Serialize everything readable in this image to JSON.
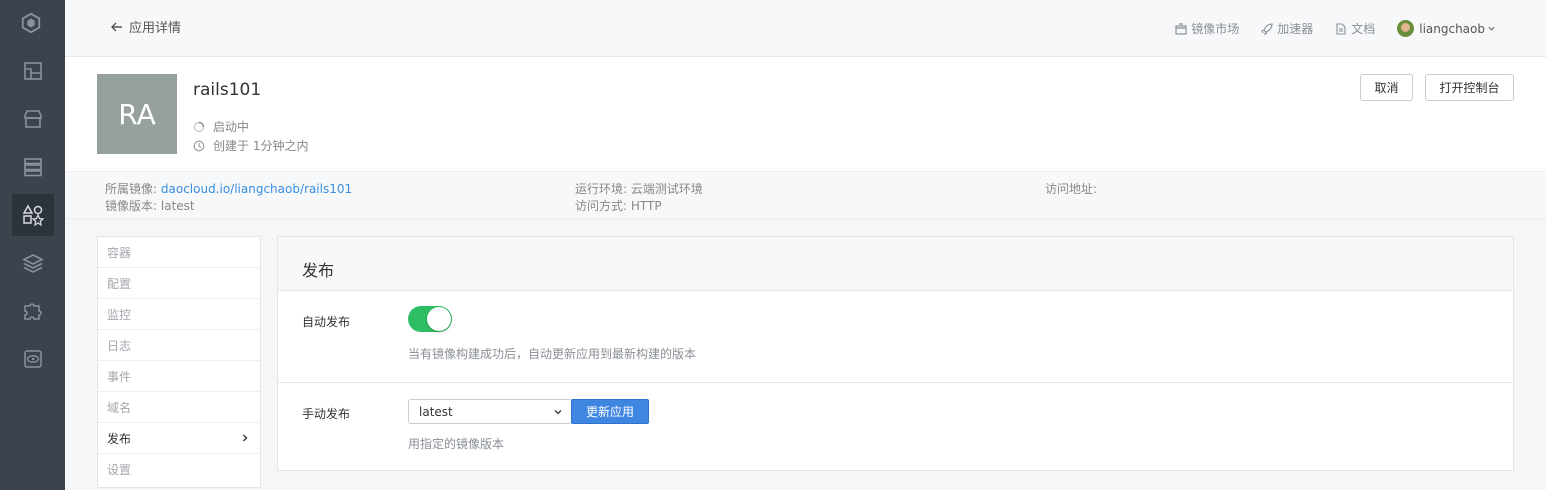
{
  "header": {
    "back_label": "应用详情",
    "nav": [
      {
        "label": "镜像市场",
        "icon": "store-icon"
      },
      {
        "label": "加速器",
        "icon": "rocket-icon"
      },
      {
        "label": "文档",
        "icon": "document-icon"
      }
    ],
    "user": {
      "name": "liangchaob"
    }
  },
  "rail": {
    "items": [
      "logo-icon",
      "dashboard-icon",
      "market-icon",
      "cluster-icon",
      "apps-icon",
      "layers-icon",
      "puzzle-icon",
      "eye-icon"
    ],
    "active": "apps-icon"
  },
  "app": {
    "initials": "RA",
    "name": "rails101",
    "status": "启动中",
    "created": "创建于 1分钟之内",
    "cancel_label": "取消",
    "console_label": "打开控制台"
  },
  "meta": {
    "image_label": "所属镜像:",
    "image_value": "daocloud.io/liangchaob/rails101",
    "version_label": "镜像版本:",
    "version_value": "latest",
    "runtime_label": "运行环境:",
    "runtime_value": "云端测试环境",
    "access_label": "访问方式:",
    "access_value": "HTTP",
    "address_label": "访问地址:"
  },
  "side_menu": {
    "items": [
      "容器",
      "配置",
      "监控",
      "日志",
      "事件",
      "域名",
      "发布",
      "设置"
    ],
    "active": "发布"
  },
  "panel": {
    "title": "发布",
    "auto_label": "自动发布",
    "auto_enabled": true,
    "auto_hint": "当有镜像构建成功后，自动更新应用到最新构建的版本",
    "manual_label": "手动发布",
    "manual_selected": "latest",
    "update_label": "更新应用",
    "manual_hint": "用指定的镜像版本"
  },
  "colors": {
    "rail": "#3c434d",
    "toggle_on": "#2dbd63",
    "primary": "#3f86e0",
    "link": "#3a8fe0"
  }
}
